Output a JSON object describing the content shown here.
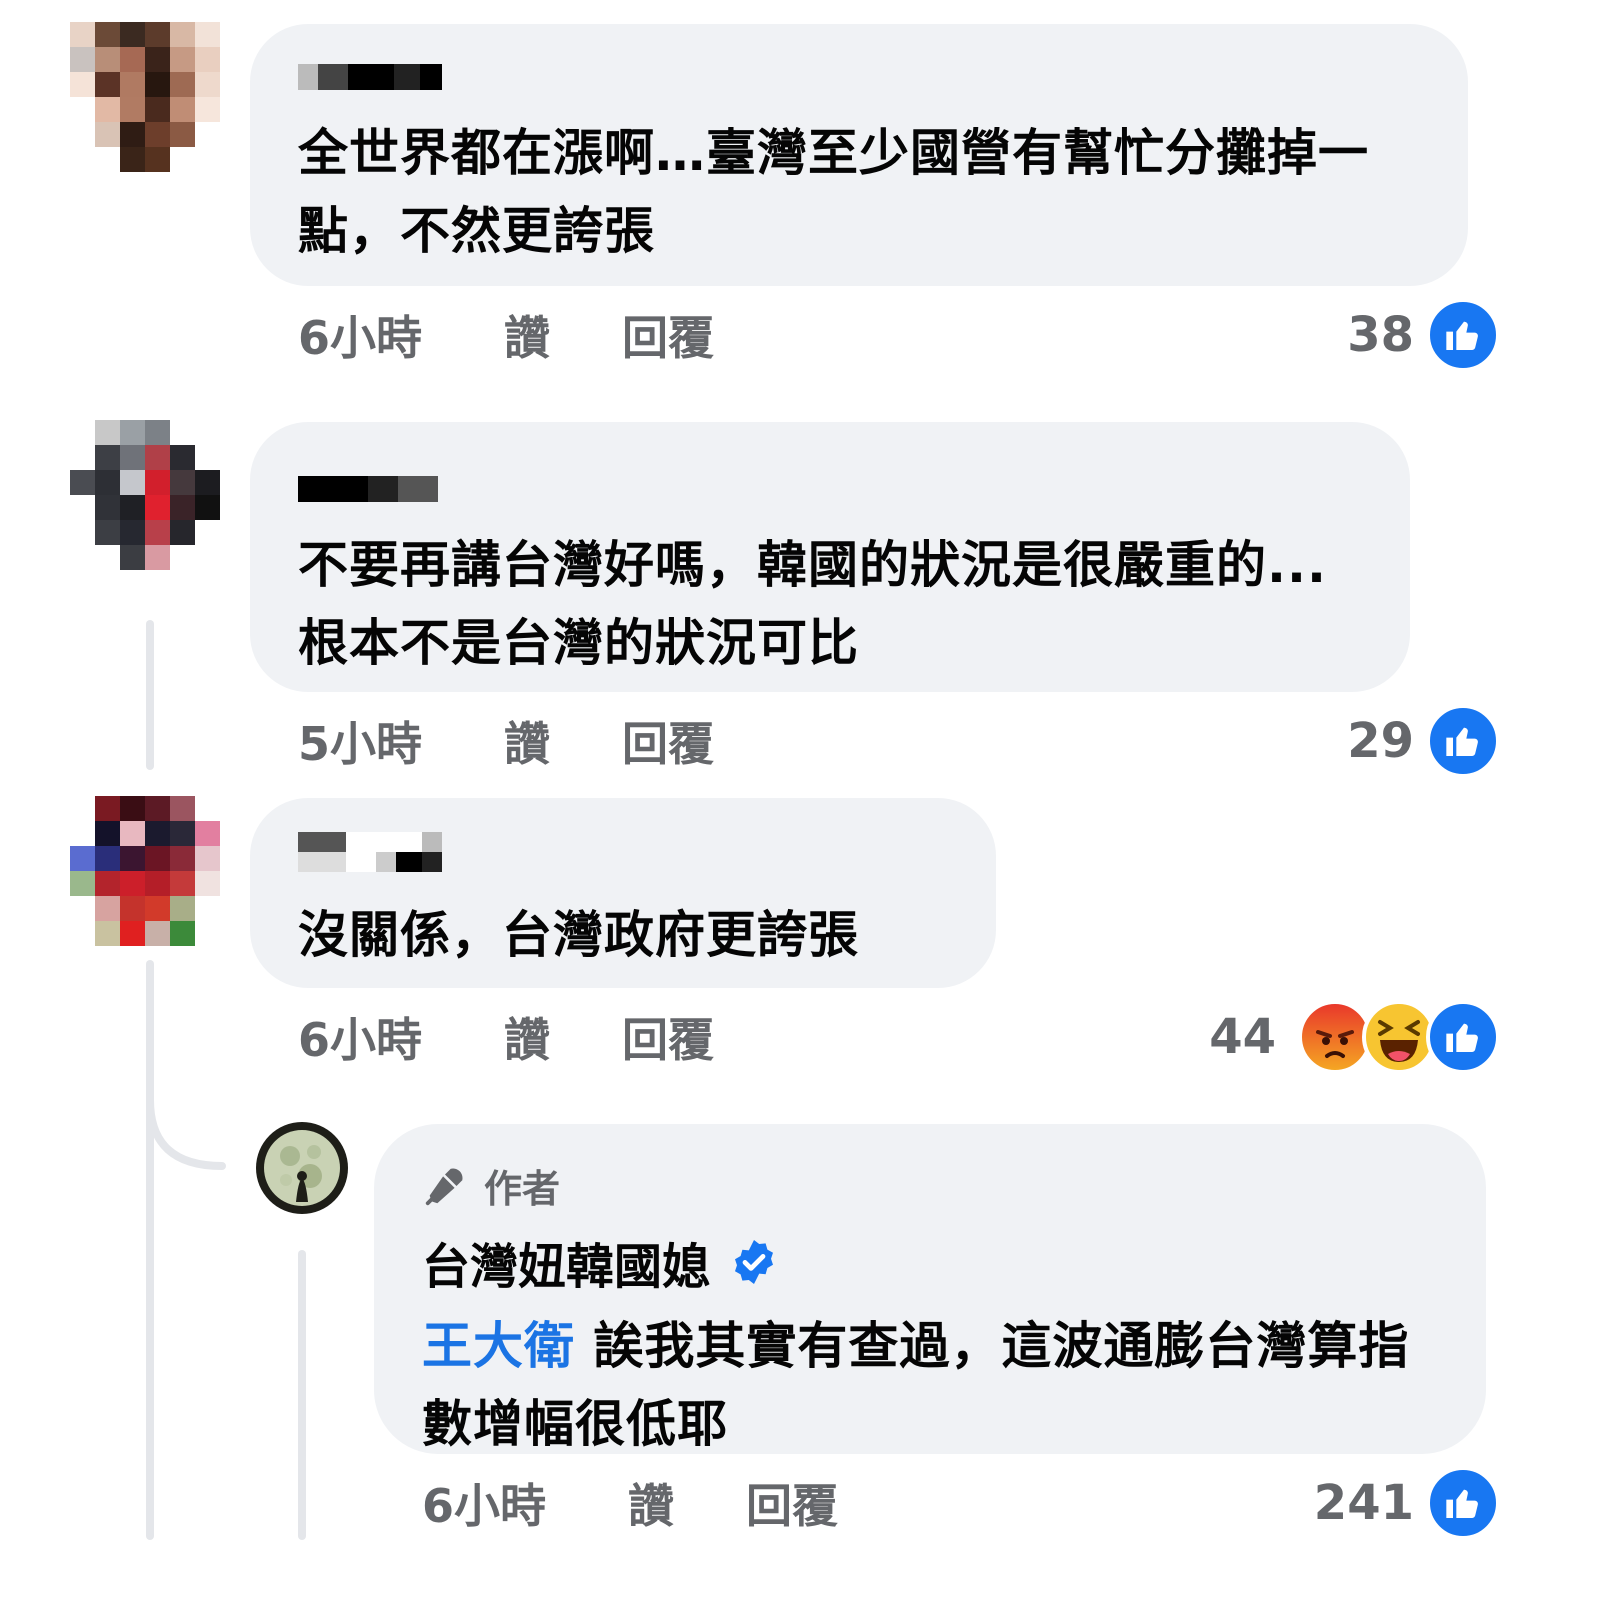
{
  "comments": [
    {
      "text": "全世界都在漲啊…臺灣至少國營有幫忙分攤掉一點，不然更誇張",
      "time": "6小時",
      "like_label": "讚",
      "reply_label": "回覆",
      "reaction_count": "38",
      "reactions": [
        "like-icon"
      ]
    },
    {
      "text": "不要再講台灣好嗎，韓國的狀況是很嚴重的...根本不是台灣的狀況可比",
      "time": "5小時",
      "like_label": "讚",
      "reply_label": "回覆",
      "reaction_count": "29",
      "reactions": [
        "like-icon"
      ]
    },
    {
      "text": "沒關係，台灣政府更誇張",
      "time": "6小時",
      "like_label": "讚",
      "reply_label": "回覆",
      "reaction_count": "44",
      "reactions": [
        "angry-icon",
        "haha-icon",
        "like-icon"
      ]
    }
  ],
  "reply": {
    "author_badge": "作者",
    "page_name": "台灣妞韓國媳",
    "mention": "王大衛",
    "text": "誒我其實有查過，這波通膨台灣算指數增幅很低耶",
    "time": "6小時",
    "like_label": "讚",
    "reply_label": "回覆",
    "reaction_count": "241",
    "reactions": [
      "like-icon"
    ]
  },
  "colors": {
    "bubble": "#f0f2f5",
    "secondary_text": "#65676b",
    "like_blue": "#1877f2",
    "mention_blue": "#1b74e4"
  }
}
